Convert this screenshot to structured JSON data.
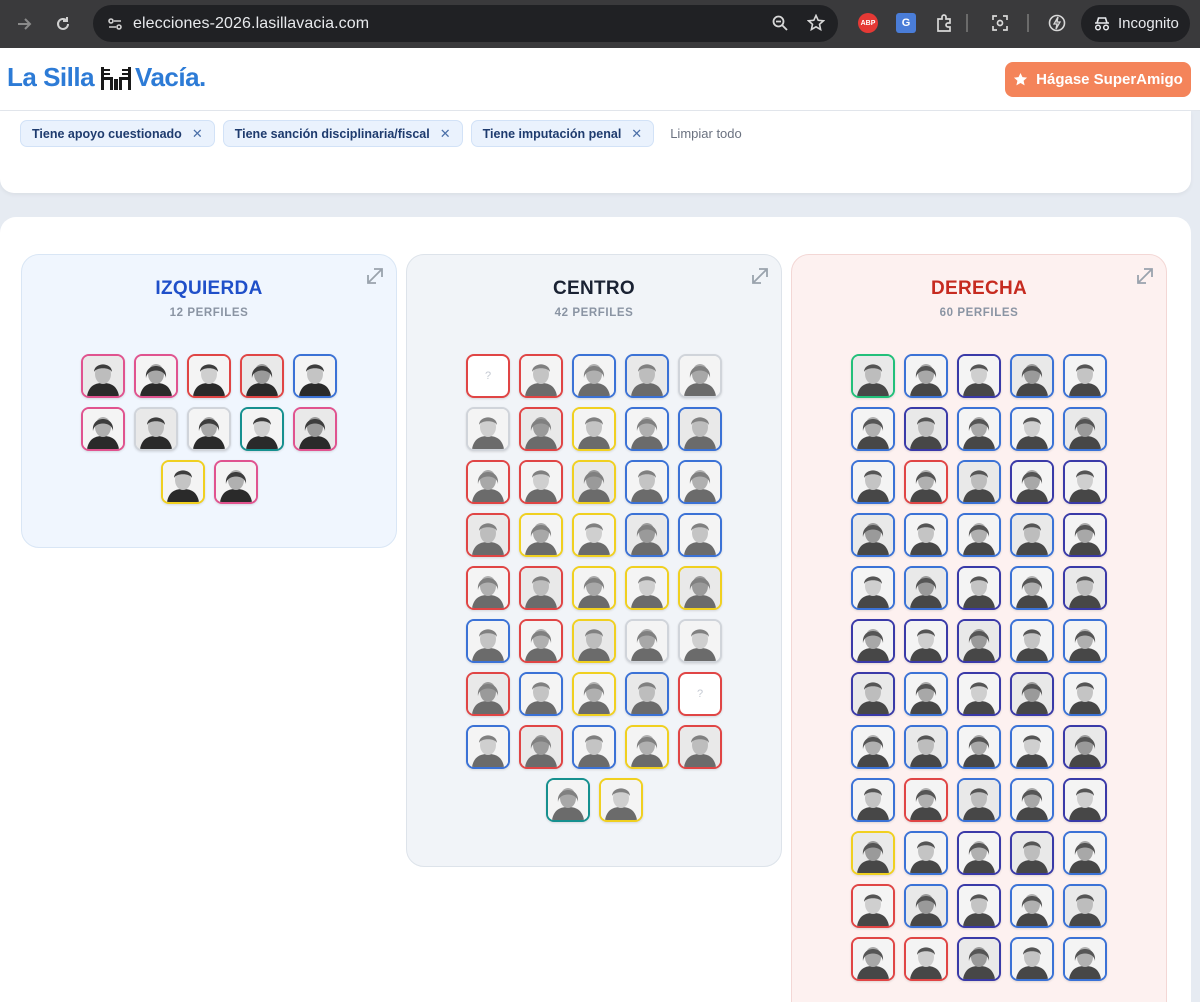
{
  "browser": {
    "url": "elecciones-2026.lasillavacia.com",
    "incognito_label": "Incognito",
    "abp_label": "ABP",
    "translate_label": "G"
  },
  "header": {
    "logo_left": "La Silla",
    "logo_right": "Vacía.",
    "cta_label": "Hágase SuperAmigo"
  },
  "filters": {
    "chips": [
      "Tiene apoyo cuestionado",
      "Tiene sanción disciplinaria/fiscal",
      "Tiene imputación penal"
    ],
    "clear_label": "Limpiar todo"
  },
  "columns": [
    {
      "title": "IZQUIERDA",
      "count": "12 PERFILES",
      "avatars": [
        "pink",
        "pink",
        "red",
        "red",
        "blue",
        "pink",
        "gray",
        "gray",
        "teal",
        "pink",
        "yellow",
        "pink"
      ]
    },
    {
      "title": "CENTRO",
      "count": "42 PERFILES",
      "avatars": [
        "red-q",
        "red",
        "blue",
        "blue",
        "gray",
        "gray",
        "red",
        "yellow",
        "blue",
        "blue",
        "red",
        "red",
        "yellow",
        "blue",
        "blue",
        "red",
        "yellow",
        "yellow",
        "blue",
        "blue",
        "red",
        "red",
        "yellow",
        "yellow",
        "yellow",
        "blue",
        "red",
        "yellow",
        "gray",
        "gray",
        "red",
        "blue",
        "yellow",
        "blue",
        "red-q",
        "blue",
        "red",
        "blue",
        "yellow",
        "red",
        "teal",
        "yellow"
      ]
    },
    {
      "title": "DERECHA",
      "count": "60 PERFILES",
      "avatars": [
        "green",
        "blue",
        "indigo",
        "blue",
        "blue",
        "blue",
        "indigo",
        "blue",
        "blue",
        "blue",
        "blue",
        "red",
        "blue",
        "indigo",
        "indigo",
        "blue",
        "blue",
        "blue",
        "blue",
        "indigo",
        "blue",
        "blue",
        "indigo",
        "blue",
        "indigo",
        "indigo",
        "indigo",
        "indigo",
        "blue",
        "blue",
        "indigo",
        "blue",
        "indigo",
        "indigo",
        "blue",
        "blue",
        "blue",
        "blue",
        "blue",
        "indigo",
        "blue",
        "red",
        "blue",
        "blue",
        "indigo",
        "yellow",
        "blue",
        "indigo",
        "indigo",
        "blue",
        "red",
        "blue",
        "indigo",
        "blue",
        "blue",
        "red",
        "red",
        "indigo",
        "blue",
        "blue"
      ]
    }
  ],
  "colors": {
    "pink": "#e0538f",
    "red": "#e04545",
    "red-q": "#e04545",
    "blue": "#3b72d6",
    "indigo": "#3a3aa8",
    "yellow": "#f0d020",
    "teal": "#16908f",
    "gray": "#d0d4da",
    "green": "#22c07a",
    "accent": "#f4845a"
  },
  "placeholder_mark": "?"
}
